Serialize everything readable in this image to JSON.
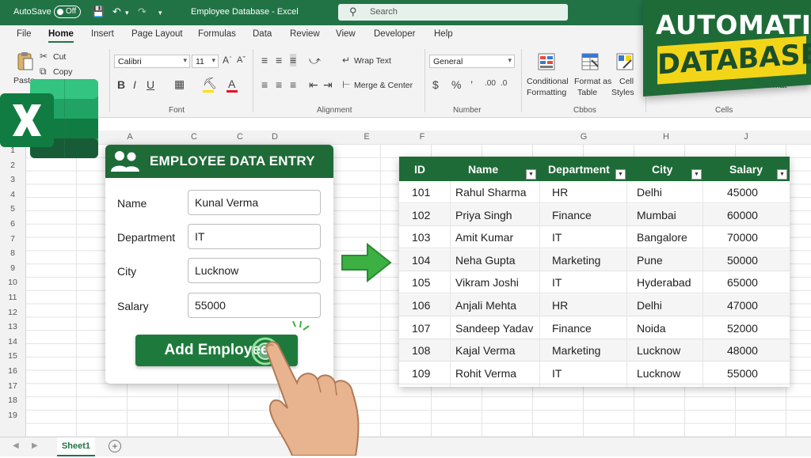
{
  "titlebar": {
    "autosave_label": "AutoSave",
    "autosave_state": "Off",
    "title": "Employee Database - Excel",
    "search_placeholder": "Search"
  },
  "menu": {
    "tabs": [
      "File",
      "Home",
      "Insert",
      "Page Layout",
      "Formulas",
      "Data",
      "Review",
      "View",
      "Developer",
      "Help"
    ],
    "active": "Home"
  },
  "ribbon": {
    "clipboard": {
      "paste": "Paste",
      "cut": "Cut",
      "copy": "Copy"
    },
    "font": {
      "name": "Calibri",
      "size": "11",
      "group": "Font"
    },
    "alignment": {
      "wrap": "Wrap Text",
      "merge": "Merge & Center",
      "group": "Alignment"
    },
    "number": {
      "format": "General",
      "group": "Number"
    },
    "styles": {
      "conditional": "Conditional",
      "conditional2": "Formatting",
      "format_as": "Format as",
      "format_as2": "Table",
      "cell": "Cell",
      "cell2": "Styles",
      "group": "Cbbos"
    },
    "cells": {
      "format": "Format",
      "group": "Cells"
    }
  },
  "grid": {
    "columns": [
      "A",
      "C",
      "C",
      "D",
      "E",
      "F",
      "G",
      "H",
      "J"
    ],
    "rows": [
      "1",
      "2",
      "3",
      "4",
      "5",
      "6",
      "7",
      "8",
      "9",
      "10",
      "11",
      "12",
      "13",
      "14",
      "15",
      "16",
      "17",
      "18",
      "19"
    ]
  },
  "badge": {
    "line1": "AUTOMATIC",
    "line2": "DATABASE"
  },
  "form": {
    "title": "EMPLOYEE DATA ENTRY",
    "fields": [
      {
        "label": "Name",
        "value": "Kunal Verma"
      },
      {
        "label": "Department",
        "value": "IT"
      },
      {
        "label": "City",
        "value": "Lucknow"
      },
      {
        "label": "Salary",
        "value": "55000"
      }
    ],
    "button": "Add Employee"
  },
  "table": {
    "headers": [
      "ID",
      "Name",
      "Department",
      "City",
      "Salary"
    ],
    "rows": [
      [
        "101",
        "Rahul Sharma",
        "HR",
        "Delhi",
        "45000"
      ],
      [
        "102",
        "Priya Singh",
        "Finance",
        "Mumbai",
        "60000"
      ],
      [
        "103",
        "Amit Kumar",
        "IT",
        "Bangalore",
        "70000"
      ],
      [
        "104",
        "Neha Gupta",
        "Marketing",
        "Pune",
        "50000"
      ],
      [
        "105",
        "Vikram Joshi",
        "IT",
        "Hyderabad",
        "65000"
      ],
      [
        "106",
        "Anjali Mehta",
        "HR",
        "Delhi",
        "47000"
      ],
      [
        "107",
        "Sandeep Yadav",
        "Finance",
        "Noida",
        "52000"
      ],
      [
        "108",
        "Kajal Verma",
        "Marketing",
        "Lucknow",
        "48000"
      ],
      [
        "109",
        "Rohit Verma",
        "IT",
        "Lucknow",
        "55000"
      ]
    ]
  },
  "sheets": {
    "active": "Sheet1"
  },
  "colors": {
    "excel_green": "#217346",
    "header_green": "#1e6b37",
    "badge_yellow": "#f3d518",
    "arrow_green": "#3cb043"
  }
}
